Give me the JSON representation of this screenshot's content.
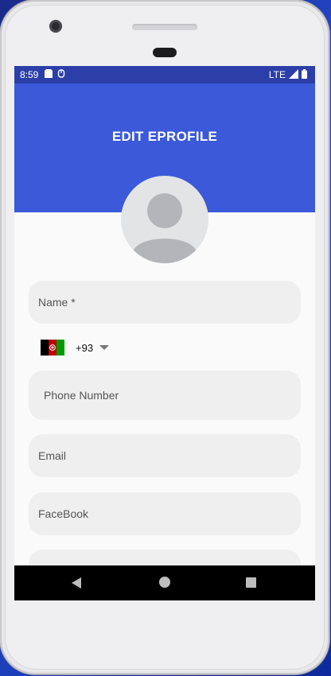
{
  "status_bar": {
    "time": "8:59",
    "network": "LTE"
  },
  "app_bar": {
    "title": "EDIT EPROFILE",
    "color": "#3b59d9"
  },
  "form": {
    "name_placeholder": "Name *",
    "country_code": "+93",
    "phone_placeholder": "Phone Number",
    "email_placeholder": "Email",
    "facebook_placeholder": "FaceBook"
  },
  "icons": {
    "avatar": "person-placeholder-icon",
    "flag": "afghanistan-flag-icon",
    "nav_back": "back-icon",
    "nav_home": "home-icon",
    "nav_recent": "recent-apps-icon"
  }
}
